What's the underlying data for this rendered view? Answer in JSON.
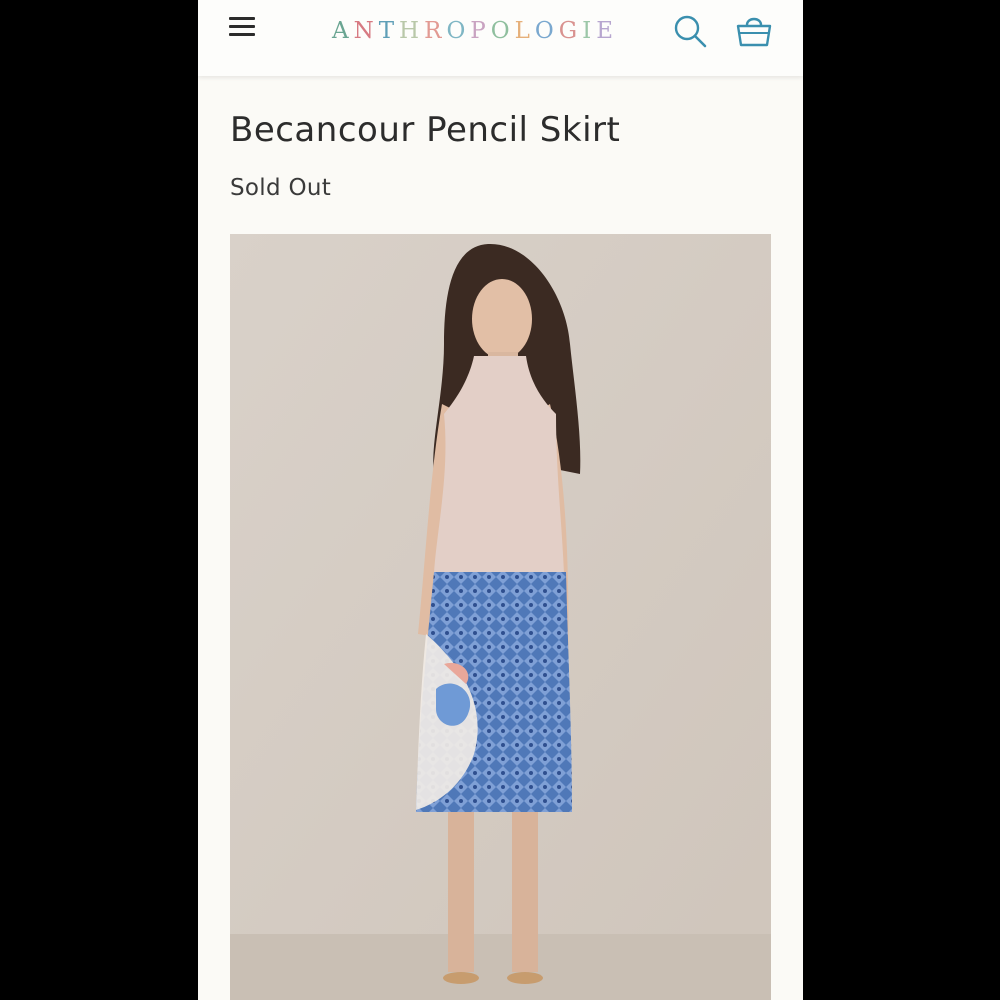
{
  "header": {
    "brand": "ANTHROPOLOGIE",
    "brand_letter_colors": [
      "#6aa592",
      "#d77a82",
      "#5f9fb7",
      "#b9c8a9",
      "#e29a93",
      "#7fb6c4",
      "#c9a3c1",
      "#8fbf9e",
      "#e6b07a",
      "#7aa8cf",
      "#d9928f",
      "#9cc7a8",
      "#b7a6cf"
    ],
    "icons": [
      "menu-icon",
      "search-icon",
      "bag-icon"
    ],
    "icon_color": "#3a8fae"
  },
  "product": {
    "title": "Becancour Pencil Skirt",
    "status": "Sold Out"
  },
  "image": {
    "subject": "product-photo",
    "background_color": "#d6cdc5"
  }
}
